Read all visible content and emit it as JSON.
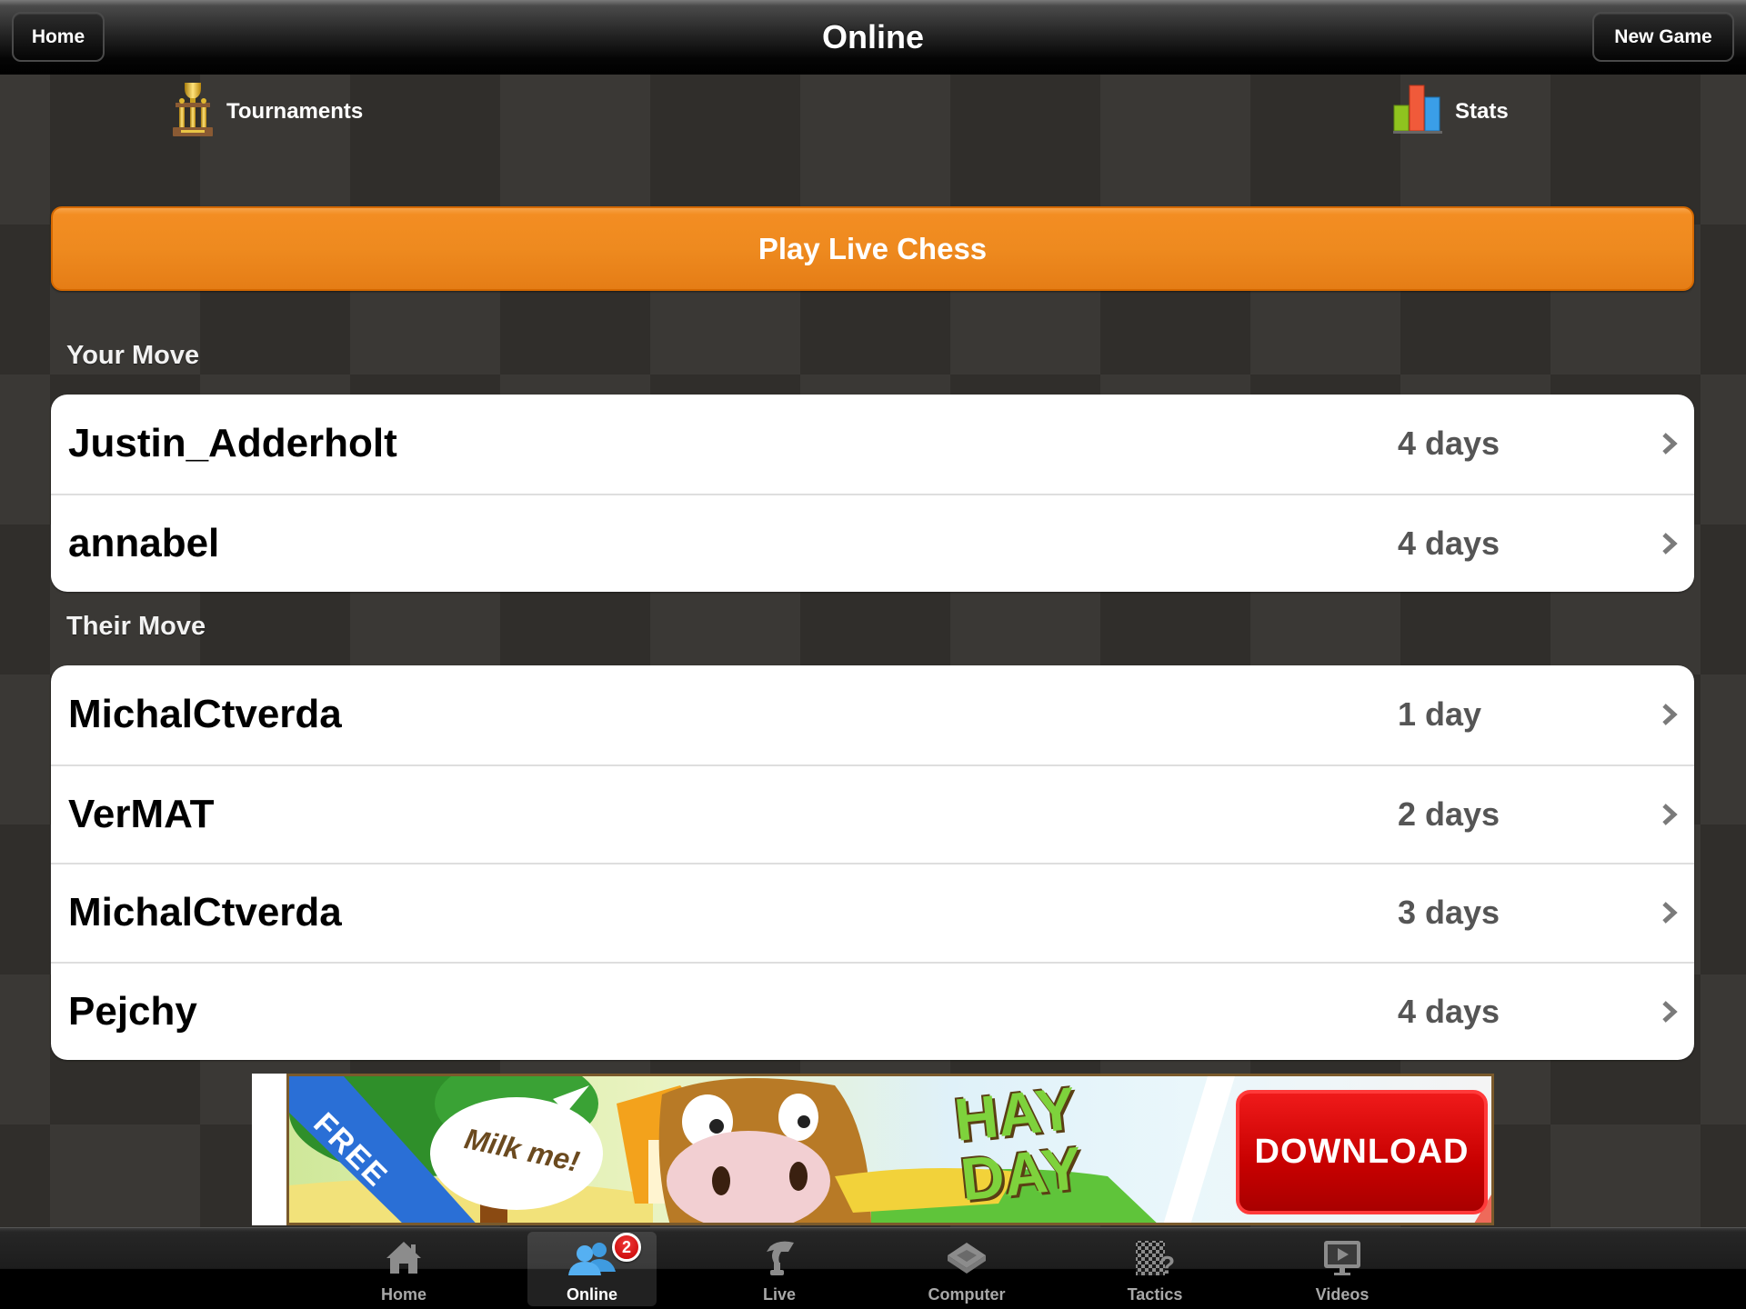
{
  "header": {
    "title": "Online",
    "home_button": "Home",
    "new_game_button": "New Game"
  },
  "top_links": {
    "tournaments": {
      "label": "Tournaments",
      "icon": "trophy-icon"
    },
    "stats": {
      "label": "Stats",
      "icon": "bar-chart-icon"
    }
  },
  "play_button": {
    "label": "Play Live Chess",
    "color": "#f28c20"
  },
  "your_move": {
    "label": "Your Move",
    "games": [
      {
        "opponent": "Justin_Adderholt",
        "time": "4 days"
      },
      {
        "opponent": "annabel",
        "time": "4 days"
      }
    ]
  },
  "their_move": {
    "label": "Their Move",
    "games": [
      {
        "opponent": "MichalCtverda",
        "time": "1 day"
      },
      {
        "opponent": "VerMAT",
        "time": "2 days"
      },
      {
        "opponent": "MichalCtverda",
        "time": "3 days"
      },
      {
        "opponent": "Pejchy",
        "time": "4 days"
      }
    ]
  },
  "ad": {
    "ribbon": "FREE",
    "speech": "Milk me!",
    "logo_line1": "HAY",
    "logo_line2": "DAY",
    "cta": "DOWNLOAD"
  },
  "tabbar": {
    "active": "Online",
    "tabs": [
      {
        "label": "Home",
        "icon": "house-icon"
      },
      {
        "label": "Online",
        "icon": "people-icon",
        "badge": "2"
      },
      {
        "label": "Live",
        "icon": "knight-icon"
      },
      {
        "label": "Computer",
        "icon": "chip-icon"
      },
      {
        "label": "Tactics",
        "icon": "checkerboard-question-icon"
      },
      {
        "label": "Videos",
        "icon": "monitor-play-icon"
      }
    ]
  }
}
